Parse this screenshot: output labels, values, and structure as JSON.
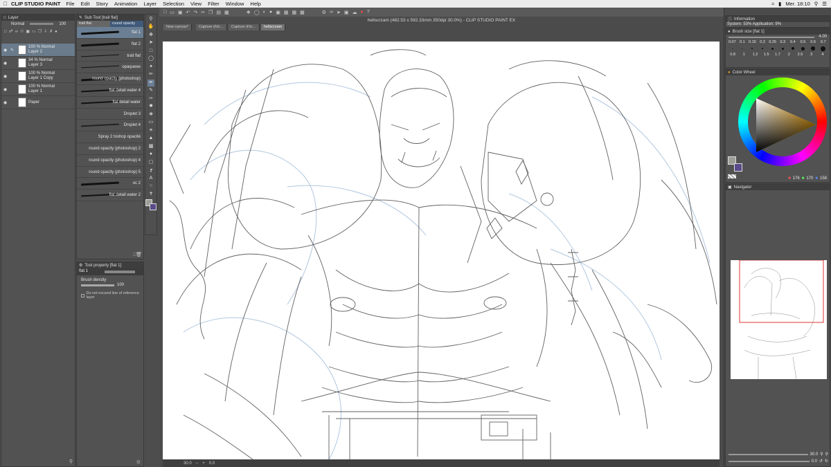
{
  "menubar": {
    "app_name": "CLIP STUDIO PAINT",
    "items": [
      "File",
      "Edit",
      "Story",
      "Animation",
      "Layer",
      "Selection",
      "View",
      "Filter",
      "Window",
      "Help"
    ],
    "clock": "Mer. 18:10"
  },
  "window_title": "hellscrzam (482.53 x 592.33mm 350dpi 30.0%)  - CLIP STUDIO PAINT EX",
  "tabs": [
    "New canvas*",
    "Capture d'éc...",
    "Capture d'éc...",
    "hellscrzam"
  ],
  "layer_panel": {
    "title": "Layer",
    "blend_mode": "Normal",
    "opacity": "100",
    "layers": [
      {
        "opacity": "100 % Normal",
        "name": "Layer 2"
      },
      {
        "opacity": "34 % Normal",
        "name": "Layer 3"
      },
      {
        "opacity": "100 % Normal",
        "name": "Layer 1 Copy"
      },
      {
        "opacity": "100 % Normal",
        "name": "Layer 1"
      },
      {
        "opacity": "",
        "name": "Paper"
      }
    ]
  },
  "subtool_panel": {
    "title": "Sub Tool [trait flat]",
    "tab1": "trait flat",
    "tab2": "round opacity",
    "brushes": [
      "flat 1",
      "flat 2",
      "trait flat",
      "opaqueee",
      "round opacity (photoshop)",
      "flat detail water 4",
      "flat detail water",
      "Droplet 3",
      "Droplet 4",
      "Spray 2 toshop opacité",
      "round opacity (photoshop) 2",
      "round opacity (photoshop) 4",
      "round opacity (photoshop) 5",
      "oc 2",
      "flat detail water 2"
    ]
  },
  "tool_property": {
    "title": "Tool property [flat 1]",
    "brush_name": "flat 1",
    "density_label": "Brush density",
    "density_value": "100",
    "checkbox_label": "Do not exceed line of reference layer"
  },
  "info_panel": {
    "title": "Information",
    "system_line": "System: 53% Application: 9%"
  },
  "brush_size_panel": {
    "title": "Brush size [flat 1]",
    "current": "4.00",
    "sizes": [
      "0.07",
      "0.1",
      "0.15",
      "0.2",
      "0.25",
      "0.3",
      "0.4",
      "0.5",
      "0.6",
      "0.7",
      "0.8",
      "1",
      "1.2",
      "1.5",
      "1.7",
      "2",
      "2.5",
      "3",
      "4"
    ]
  },
  "color_wheel": {
    "title": "Color Wheel",
    "r": "176",
    "g": "170",
    "b": "158",
    "main_color": "#9e9e98",
    "sub_color": "#5a4a8a"
  },
  "navigator": {
    "title": "Navigator",
    "zoom": "30.0",
    "angle": "0.0"
  },
  "status": {
    "zoom": "30.0",
    "angle": "0.0"
  }
}
